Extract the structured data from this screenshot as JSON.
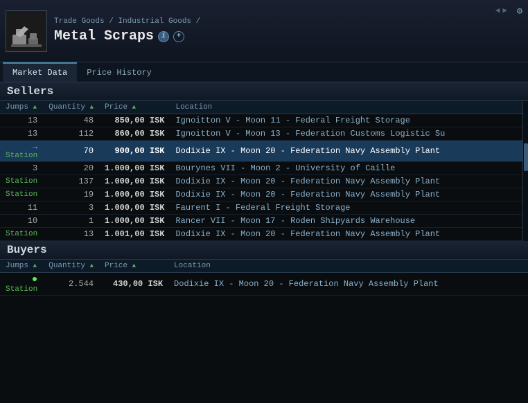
{
  "header": {
    "breadcrumb": "Trade Goods / Industrial Goods /",
    "title": "Metal Scraps",
    "info_btn": "i",
    "add_btn": "+"
  },
  "tabs": [
    {
      "id": "market-data",
      "label": "Market Data",
      "active": true
    },
    {
      "id": "price-history",
      "label": "Price History",
      "active": false
    }
  ],
  "sellers": {
    "section_label": "Sellers",
    "columns": [
      {
        "id": "jumps",
        "label": "Jumps",
        "sort": "asc"
      },
      {
        "id": "quantity",
        "label": "Quantity",
        "sort": "asc"
      },
      {
        "id": "price",
        "label": "Price",
        "sort": "asc"
      },
      {
        "id": "location",
        "label": "Location"
      }
    ],
    "rows": [
      {
        "jumps": "13",
        "quantity": "48",
        "price": "850,00 ISK",
        "location": "Ignoitton V - Moon 11 - Federal Freight Storage",
        "highlight": false,
        "station": false
      },
      {
        "jumps": "13",
        "quantity": "112",
        "price": "860,00 ISK",
        "location": "Ignoitton V - Moon 13 - Federation Customs Logistic Su",
        "highlight": false,
        "station": false
      },
      {
        "jumps": "→ Station",
        "quantity": "70",
        "price": "900,00 ISK",
        "location": "Dodixie IX - Moon 20 - Federation Navy Assembly Plant",
        "highlight": true,
        "station": true,
        "arrow": true
      },
      {
        "jumps": "3",
        "quantity": "20",
        "price": "1.000,00 ISK",
        "location": "Bourynes VII - Moon 2 - University of Caille",
        "highlight": false,
        "station": false
      },
      {
        "jumps": "Station",
        "quantity": "137",
        "price": "1.000,00 ISK",
        "location": "Dodixie IX - Moon 20 - Federation Navy Assembly Plant",
        "highlight": false,
        "station": true
      },
      {
        "jumps": "Station",
        "quantity": "19",
        "price": "1.000,00 ISK",
        "location": "Dodixie IX - Moon 20 - Federation Navy Assembly Plant",
        "highlight": false,
        "station": true
      },
      {
        "jumps": "11",
        "quantity": "3",
        "price": "1.000,00 ISK",
        "location": "Faurent I - Federal Freight Storage",
        "highlight": false,
        "station": false
      },
      {
        "jumps": "10",
        "quantity": "1",
        "price": "1.000,00 ISK",
        "location": "Rancer VII - Moon 17 - Roden Shipyards Warehouse",
        "highlight": false,
        "station": false
      },
      {
        "jumps": "Station",
        "quantity": "13",
        "price": "1.001,00 ISK",
        "location": "Dodixie IX - Moon 20 - Federation Navy Assembly Plant",
        "highlight": false,
        "station": true
      }
    ]
  },
  "buyers": {
    "section_label": "Buyers",
    "columns": [
      {
        "id": "jumps",
        "label": "Jumps",
        "sort": "asc"
      },
      {
        "id": "quantity",
        "label": "Quantity",
        "sort": "asc"
      },
      {
        "id": "price",
        "label": "Price",
        "sort": "asc"
      },
      {
        "id": "location",
        "label": "Location"
      }
    ],
    "rows": [
      {
        "jumps": "Station",
        "quantity": "2.544",
        "price": "430,00 ISK",
        "location": "Dodixie IX - Moon 20 - Federation Navy Assembly Plant",
        "highlight": false,
        "station": true,
        "dot": true
      }
    ]
  }
}
